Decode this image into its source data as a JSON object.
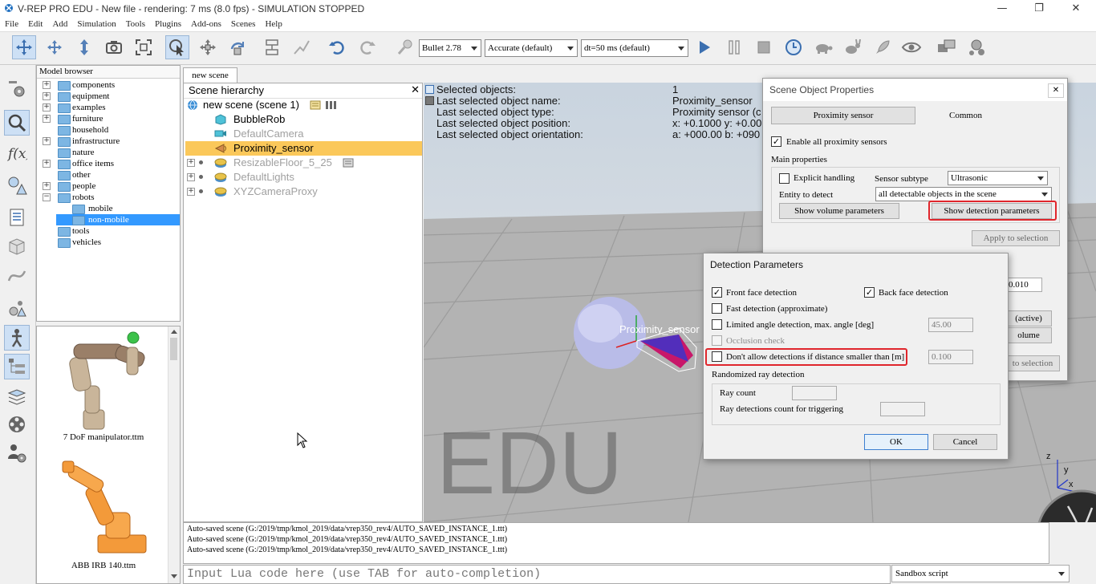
{
  "window": {
    "title": "V-REP PRO EDU - New file - rendering: 7 ms (8.0 fps) - SIMULATION STOPPED",
    "minimize": "—",
    "restore": "❐",
    "close": "✕"
  },
  "menu": [
    "File",
    "Edit",
    "Add",
    "Simulation",
    "Tools",
    "Plugins",
    "Add-ons",
    "Scenes",
    "Help"
  ],
  "toolbar": {
    "engine": "Bullet 2.78",
    "accuracy": "Accurate (default)",
    "timestep": "dt=50 ms (default)"
  },
  "model_browser": {
    "header": "Model browser",
    "items": [
      "components",
      "equipment",
      "examples",
      "furniture",
      "household",
      "infrastructure",
      "nature",
      "office items",
      "other",
      "people",
      "robots",
      "mobile",
      "non-mobile",
      "tools",
      "vehicles"
    ]
  },
  "thumbnails": [
    {
      "caption": "7 DoF manipulator.ttm"
    },
    {
      "caption": "ABB IRB 140.ttm"
    }
  ],
  "scene_tab": "new scene",
  "hierarchy": {
    "title": "Scene hierarchy",
    "close": "✕",
    "root": "new scene (scene 1)",
    "rows": [
      "BubbleRob",
      "DefaultCamera",
      "Proximity_sensor",
      "ResizableFloor_5_25",
      "DefaultLights",
      "XYZCameraProxy"
    ]
  },
  "viewport": {
    "info_labels": [
      "Selected objects:",
      "Last selected object name:",
      "Last selected object type:",
      "Last selected object position:",
      "Last selected object orientation:"
    ],
    "info_values": [
      "1",
      "Proximity_sensor",
      "Proximity sensor (c",
      "x: +0.1000    y: +0.00",
      "a: +000.00    b: +090"
    ],
    "object_label": "Proximity_sensor",
    "watermark": "EDU",
    "axis_z": "z",
    "axis_y": "y",
    "axis_x": "x"
  },
  "props_dialog": {
    "title": "Scene Object Properties",
    "tab_active": "Proximity sensor",
    "tab_other": "Common",
    "enable_all": "Enable all proximity sensors",
    "main_properties": "Main properties",
    "explicit_handling": "Explicit handling",
    "sensor_subtype_label": "Sensor subtype",
    "sensor_subtype": "Ultrasonic",
    "entity_label": "Entity to detect",
    "entity": "all detectable objects in the scene",
    "show_volume": "Show volume parameters",
    "show_detection": "Show detection parameters",
    "apply": "Apply to selection",
    "partial_value": "0.010",
    "partial_active": "(active)",
    "partial_volume": "olume",
    "partial_apply": "to selection"
  },
  "detection_dialog": {
    "title": "Detection Parameters",
    "front_face": "Front face detection",
    "back_face": "Back face detection",
    "fast_detection": "Fast detection (approximate)",
    "limited_angle": "Limited angle detection, max. angle [deg]",
    "limited_angle_value": "45.00",
    "occlusion": "Occlusion check",
    "min_distance": "Don't allow detections if distance smaller than [m]",
    "min_distance_value": "0.100",
    "randomized": "Randomized ray detection",
    "ray_count": "Ray count",
    "ray_trigger": "Ray detections count for triggering",
    "ok": "OK",
    "cancel": "Cancel",
    "check": "✓"
  },
  "console": {
    "lines": [
      "Auto-saved scene (G:/2019/tmp/kmol_2019/data/vrep350_rev4/AUTO_SAVED_INSTANCE_1.ttt)",
      "Auto-saved scene (G:/2019/tmp/kmol_2019/data/vrep350_rev4/AUTO_SAVED_INSTANCE_1.ttt)",
      "Auto-saved scene (G:/2019/tmp/kmol_2019/data/vrep350_rev4/AUTO_SAVED_INSTANCE_1.ttt)"
    ]
  },
  "lua_input": {
    "placeholder": "Input Lua code here (use TAB for auto-completion)"
  },
  "sandbox": "Sandbox script",
  "colors": {
    "selection": "#3399ff",
    "highlight": "#fbc85a",
    "annotation": "#e0262c"
  }
}
